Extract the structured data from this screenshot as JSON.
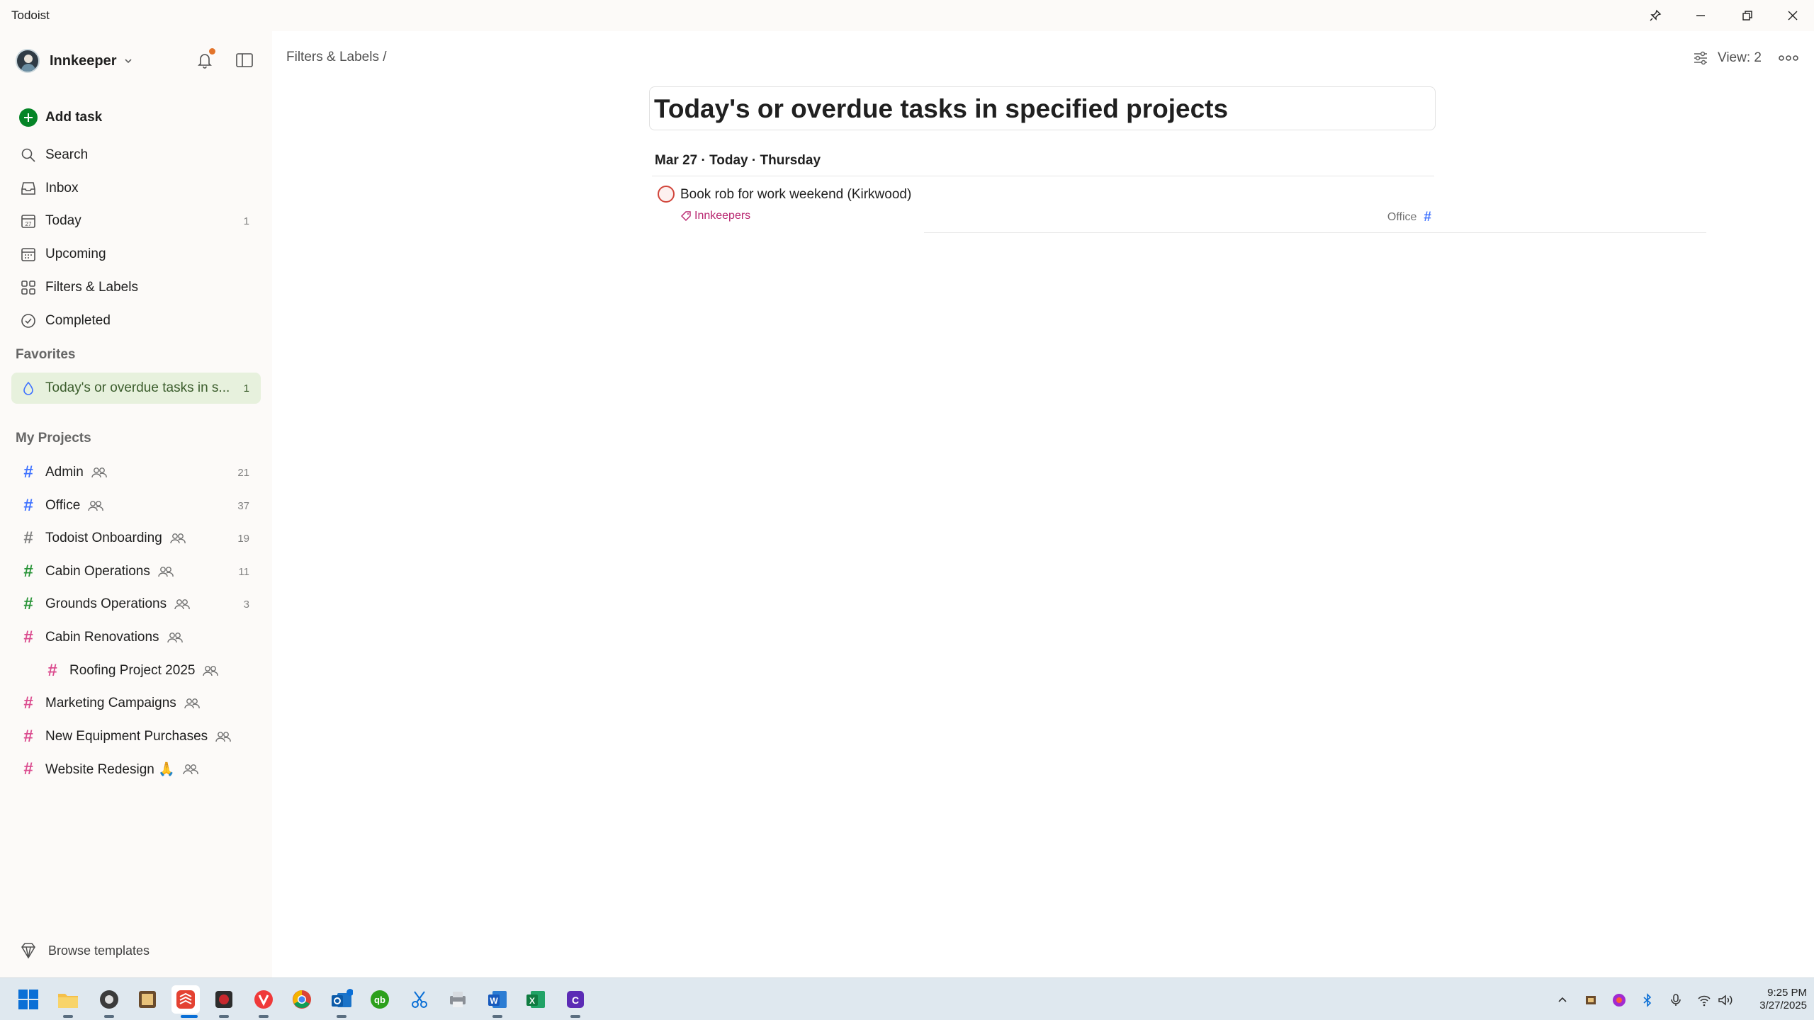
{
  "window": {
    "title": "Todoist"
  },
  "sidebar": {
    "user": "Innkeeper",
    "add_task": "Add task",
    "nav": [
      {
        "label": "Search",
        "icon": "search-icon"
      },
      {
        "label": "Inbox",
        "icon": "inbox-icon"
      },
      {
        "label": "Today",
        "icon": "calendar-today-icon",
        "count": "1"
      },
      {
        "label": "Upcoming",
        "icon": "calendar-upcoming-icon"
      },
      {
        "label": "Filters & Labels",
        "icon": "filters-labels-icon"
      },
      {
        "label": "Completed",
        "icon": "check-circle-icon"
      }
    ],
    "favorites_title": "Favorites",
    "favorites": [
      {
        "label": "Today's or overdue tasks in s...",
        "count": "1",
        "icon": "filter-drop-icon"
      }
    ],
    "projects_title": "My Projects",
    "projects": [
      {
        "label": "Admin",
        "count": "21",
        "color": "#4073ff",
        "shared": true
      },
      {
        "label": "Office",
        "count": "37",
        "color": "#4073ff",
        "shared": true
      },
      {
        "label": "Todoist Onboarding",
        "count": "19",
        "color": "#808080",
        "shared": true
      },
      {
        "label": "Cabin Operations",
        "count": "11",
        "color": "#299438",
        "shared": true
      },
      {
        "label": "Grounds Operations",
        "count": "3",
        "color": "#299438",
        "shared": true
      },
      {
        "label": "Cabin Renovations",
        "count": "",
        "color": "#db4c8f",
        "shared": true
      },
      {
        "label": "Roofing Project 2025",
        "count": "",
        "color": "#db4c8f",
        "shared": true,
        "sub": true
      },
      {
        "label": "Marketing Campaigns",
        "count": "",
        "color": "#db4c8f",
        "shared": true
      },
      {
        "label": "New Equipment Purchases",
        "count": "",
        "color": "#db4c8f",
        "shared": true
      },
      {
        "label": "Website Redesign 🙏",
        "count": "",
        "color": "#db4c8f",
        "shared": true
      }
    ],
    "browse_templates": "Browse templates"
  },
  "main": {
    "breadcrumb": "Filters & Labels /",
    "view_label": "View: 2",
    "title": "Today's or overdue tasks in specified projects",
    "date_header": "Mar 27 · Today · Thursday",
    "tasks": [
      {
        "title": "Book rob for work weekend (Kirkwood)",
        "label": "Innkeepers",
        "project": "Office",
        "priority_color": "#d1453b"
      }
    ]
  },
  "taskbar": {
    "time": "9:25 PM",
    "date": "3/27/2025"
  },
  "colors": {
    "accent_green": "#058527",
    "favorite_bg": "#e7f1dd",
    "label_color": "#b8256f",
    "project_blue": "#4073ff"
  }
}
